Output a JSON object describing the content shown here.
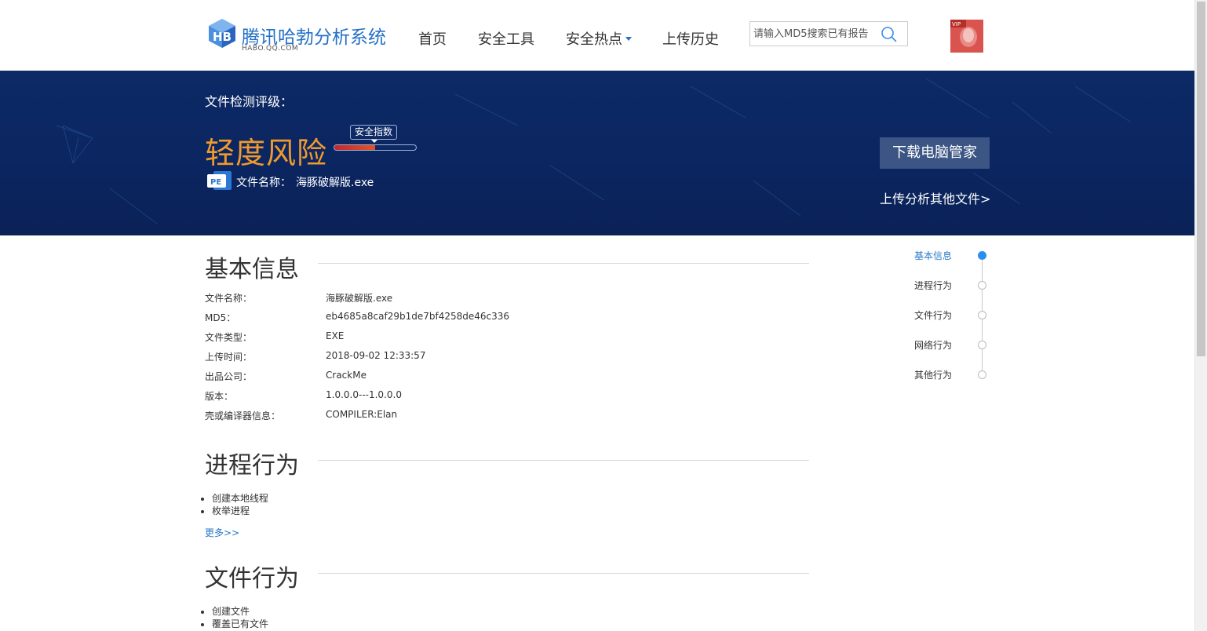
{
  "header": {
    "logo_title": "腾讯哈勃分析系统",
    "logo_sub": "HABO.QQ.COM",
    "nav": [
      {
        "label": "首页"
      },
      {
        "label": "安全工具"
      },
      {
        "label": "安全热点"
      },
      {
        "label": "上传历史"
      }
    ],
    "search_placeholder": "请输入MD5搜索已有报告",
    "avatar_badge": "VIP"
  },
  "banner": {
    "rating_label": "文件检测评级：",
    "risk_level": "轻度风险",
    "safety_tag": "安全指数",
    "safety_level": 0.5,
    "file_type_icon": "PE",
    "file_name_label": "文件名称：",
    "file_name": "海豚破解版.exe",
    "download_button": "下载电脑管家",
    "upload_link": "上传分析其他文件>"
  },
  "basic_info": {
    "title": "基本信息",
    "rows": [
      {
        "label": "文件名称：",
        "value": "海豚破解版.exe"
      },
      {
        "label": "MD5：",
        "value": "eb4685a8caf29b1de7bf4258de46c336"
      },
      {
        "label": "文件类型：",
        "value": "EXE"
      },
      {
        "label": "上传时间：",
        "value": "2018-09-02 12:33:57"
      },
      {
        "label": "出品公司：",
        "value": "CrackMe"
      },
      {
        "label": "版本：",
        "value": "1.0.0.0---1.0.0.0"
      },
      {
        "label": "壳或编译器信息：",
        "value": "COMPILER:Elan"
      }
    ]
  },
  "process_behavior": {
    "title": "进程行为",
    "items": [
      "创建本地线程",
      "枚举进程"
    ],
    "more": "更多>>"
  },
  "file_behavior": {
    "title": "文件行为",
    "items": [
      "创建文件",
      "覆盖已有文件"
    ]
  },
  "side_nav": {
    "items": [
      "基本信息",
      "进程行为",
      "文件行为",
      "网络行为",
      "其他行为"
    ],
    "active_index": 0
  },
  "colors": {
    "brand_blue": "#2370c8",
    "banner_bg": "#0d2a66",
    "risk_orange": "#f09a2e",
    "link_blue": "#2a78c8"
  }
}
